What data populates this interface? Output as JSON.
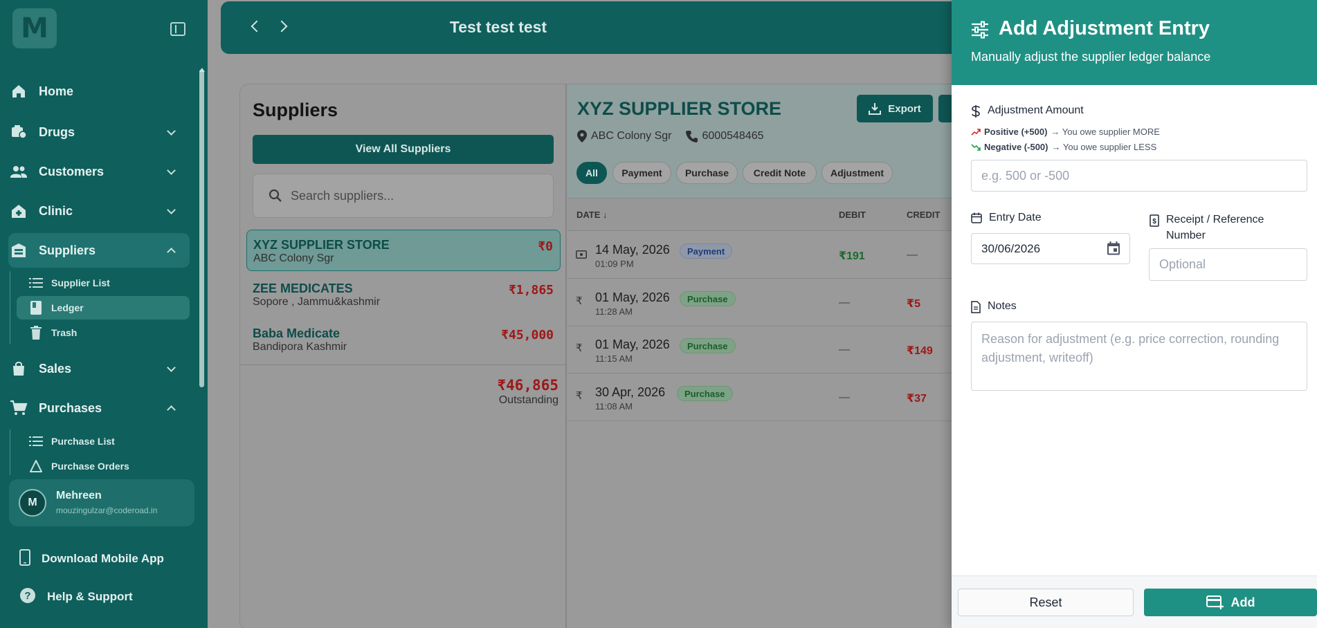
{
  "sidebar": {
    "logo_letter": "M",
    "items": [
      {
        "label": "Home",
        "icon": "home-icon"
      },
      {
        "label": "Drugs",
        "icon": "pill-icon"
      },
      {
        "label": "Customers",
        "icon": "people-icon"
      },
      {
        "label": "Clinic",
        "icon": "clinic-icon"
      },
      {
        "label": "Suppliers",
        "icon": "warehouse-icon"
      },
      {
        "label": "Sales",
        "icon": "shopping-bag-icon"
      },
      {
        "label": "Purchases",
        "icon": "cart-icon"
      }
    ],
    "supplier_sub": [
      {
        "label": "Supplier List",
        "icon": "list-icon"
      },
      {
        "label": "Ledger",
        "icon": "book-icon"
      },
      {
        "label": "Trash",
        "icon": "trash-icon"
      }
    ],
    "purchase_sub": [
      {
        "label": "Purchase List",
        "icon": "list-icon"
      },
      {
        "label": "Purchase Orders",
        "icon": "cone-icon"
      }
    ],
    "user": {
      "initial": "M",
      "name": "Mehreen",
      "email": "mouzingulzar@coderoad.in"
    },
    "download_app": "Download Mobile App",
    "help": "Help & Support"
  },
  "topbar": {
    "title": "Test test test"
  },
  "suppliers": {
    "title": "Suppliers",
    "view_all": "View All Suppliers",
    "search_placeholder": "Search suppliers...",
    "list": [
      {
        "name": "XYZ SUPPLIER STORE",
        "address": "ABC Colony Sgr",
        "amount": "₹0"
      },
      {
        "name": "ZEE MEDICATES",
        "address": "Sopore , Jammu&kashmir",
        "amount": "₹1,865"
      },
      {
        "name": "Baba Medicate",
        "address": "Bandipora Kashmir",
        "amount": "₹45,000"
      }
    ],
    "total": "₹46,865",
    "total_label": "Outstanding"
  },
  "ledger": {
    "name": "XYZ SUPPLIER STORE",
    "location": "ABC Colony Sgr",
    "phone": "6000548465",
    "export": "Export",
    "filters": [
      "All",
      "Payment",
      "Purchase",
      "Credit Note",
      "Adjustment"
    ],
    "columns": {
      "date": "DATE ↓",
      "debit": "DEBIT",
      "credit": "CREDIT"
    },
    "rows": [
      {
        "date": "14 May, 2026",
        "time": "01:09 PM",
        "type": "Payment",
        "debit": "₹191",
        "credit": "—"
      },
      {
        "date": "01 May, 2026",
        "time": "11:28 AM",
        "type": "Purchase",
        "debit": "—",
        "credit": "₹5"
      },
      {
        "date": "01 May, 2026",
        "time": "11:15 AM",
        "type": "Purchase",
        "debit": "—",
        "credit": "₹149"
      },
      {
        "date": "30 Apr, 2026",
        "time": "11:08 AM",
        "type": "Purchase",
        "debit": "—",
        "credit": "₹37"
      }
    ]
  },
  "drawer": {
    "title": "Add Adjustment Entry",
    "subtitle": "Manually adjust the supplier ledger balance",
    "amount_label": "Adjustment Amount",
    "hint_positive_bold": "Positive (+500)",
    "hint_positive_text": "→ You owe supplier MORE",
    "hint_negative_bold": "Negative (-500)",
    "hint_negative_text": "→ You owe supplier LESS",
    "amount_placeholder": "e.g. 500 or -500",
    "date_label": "Entry Date",
    "date_value": "30/06/2026",
    "ref_label": "Receipt / Reference Number",
    "ref_placeholder": "Optional",
    "notes_label": "Notes",
    "notes_placeholder": "Reason for adjustment (e.g. price correction, rounding adjustment, writeoff)",
    "reset": "Reset",
    "add": "Add"
  },
  "colors": {
    "brand": "#0f5f5c",
    "accent": "#1f9184",
    "danger": "#9d1818",
    "success": "#1a6b2b"
  }
}
